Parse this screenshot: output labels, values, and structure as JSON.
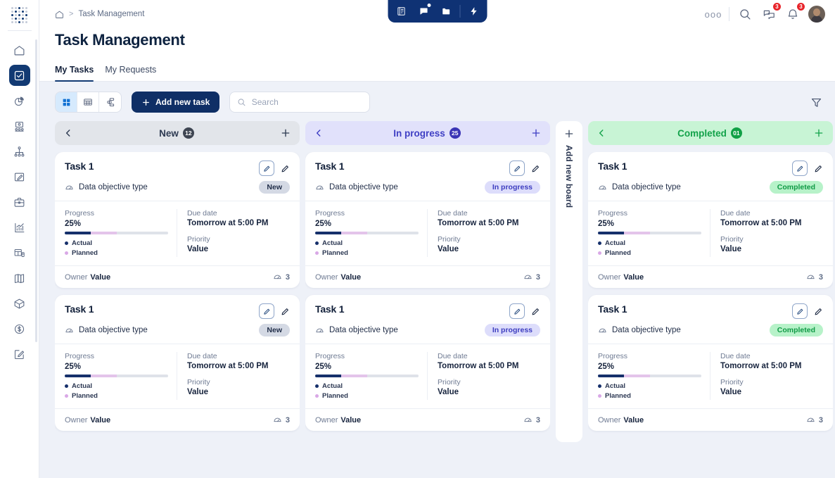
{
  "app": {
    "logo_name": "dots-logo"
  },
  "sidebar": {
    "items": [
      {
        "label": "Home",
        "icon": "home-icon",
        "active": false
      },
      {
        "label": "Tasks",
        "icon": "checkbox-icon",
        "active": true
      },
      {
        "label": "Analytics",
        "icon": "pie-chart-icon",
        "active": false
      },
      {
        "label": "Presentation",
        "icon": "presentation-people-icon",
        "active": false
      },
      {
        "label": "Org chart",
        "icon": "org-chart-icon",
        "active": false
      },
      {
        "label": "Edit document",
        "icon": "edit-document-icon",
        "active": false
      },
      {
        "label": "Portfolio",
        "icon": "briefcase-icon",
        "active": false
      },
      {
        "label": "Reports",
        "icon": "bar-chart-icon",
        "active": false
      },
      {
        "label": "Data tables",
        "icon": "table-database-icon",
        "active": false
      },
      {
        "label": "Catalog",
        "icon": "book-icon",
        "active": false
      },
      {
        "label": "Assets",
        "icon": "cube-icon",
        "active": false
      },
      {
        "label": "Finance",
        "icon": "dollar-circle-icon",
        "active": false
      },
      {
        "label": "Sign",
        "icon": "signature-icon",
        "active": false
      }
    ]
  },
  "topbar": {
    "breadcrumb_home": "home-icon",
    "breadcrumb_separator": ">",
    "breadcrumb_current": "Task Management",
    "center_tools": [
      {
        "name": "list-document-icon"
      },
      {
        "name": "chat-icon",
        "has_dot": true
      },
      {
        "name": "folder-icon"
      },
      {
        "name": "lightning-icon"
      }
    ],
    "more_label": "ooo",
    "search_icon": "search-icon",
    "messages_badge": "3",
    "notifications_badge": "3",
    "avatar_name": "user-avatar"
  },
  "page": {
    "title": "Task Management"
  },
  "tabs": [
    {
      "label": "My Tasks",
      "active": true
    },
    {
      "label": "My Requests",
      "active": false
    }
  ],
  "toolbar": {
    "views": [
      {
        "name": "grid-view-icon",
        "active": true
      },
      {
        "name": "table-view-icon",
        "active": false
      },
      {
        "name": "tree-view-icon",
        "active": false
      }
    ],
    "add_task_label": "Add new task",
    "search_placeholder": "Search",
    "search_value": "",
    "filter_icon": "filter-icon"
  },
  "add_board": {
    "label": "Add new board",
    "icon": "plus-icon"
  },
  "columns": [
    {
      "title": "New",
      "count": "12",
      "theme": "new",
      "cards": [
        {
          "title": "Task 1",
          "objective_type": "Data objective type",
          "status": "New",
          "progress_label": "Progress",
          "progress_value": "25%",
          "progress_actual": 25,
          "progress_planned": 25,
          "legend_actual": "Actual",
          "legend_planned": "Planned",
          "due_label": "Due date",
          "due_value": "Tomorrow at 5:00 PM",
          "priority_label": "Priority",
          "priority_value": "Value",
          "owner_label": "Owner",
          "owner_value": "Value",
          "objective_count": "3"
        },
        {
          "title": "Task 1",
          "objective_type": "Data objective type",
          "status": "New",
          "progress_label": "Progress",
          "progress_value": "25%",
          "progress_actual": 25,
          "progress_planned": 25,
          "legend_actual": "Actual",
          "legend_planned": "Planned",
          "due_label": "Due date",
          "due_value": "Tomorrow at 5:00 PM",
          "priority_label": "Priority",
          "priority_value": "Value",
          "owner_label": "Owner",
          "owner_value": "Value",
          "objective_count": "3"
        }
      ]
    },
    {
      "title": "In progress",
      "count": "25",
      "theme": "prog",
      "cards": [
        {
          "title": "Task 1",
          "objective_type": "Data objective type",
          "status": "In progress",
          "progress_label": "Progress",
          "progress_value": "25%",
          "progress_actual": 25,
          "progress_planned": 25,
          "legend_actual": "Actual",
          "legend_planned": "Planned",
          "due_label": "Due date",
          "due_value": "Tomorrow at 5:00 PM",
          "priority_label": "Priority",
          "priority_value": "Value",
          "owner_label": "Owner",
          "owner_value": "Value",
          "objective_count": "3"
        },
        {
          "title": "Task 1",
          "objective_type": "Data objective type",
          "status": "In progress",
          "progress_label": "Progress",
          "progress_value": "25%",
          "progress_actual": 25,
          "progress_planned": 25,
          "legend_actual": "Actual",
          "legend_planned": "Planned",
          "due_label": "Due date",
          "due_value": "Tomorrow at 5:00 PM",
          "priority_label": "Priority",
          "priority_value": "Value",
          "owner_label": "Owner",
          "owner_value": "Value",
          "objective_count": "3"
        }
      ]
    },
    {
      "title": "Completed",
      "count": "01",
      "theme": "done",
      "cards": [
        {
          "title": "Task 1",
          "objective_type": "Data objective type",
          "status": "Completed",
          "progress_label": "Progress",
          "progress_value": "25%",
          "progress_actual": 25,
          "progress_planned": 25,
          "legend_actual": "Actual",
          "legend_planned": "Planned",
          "due_label": "Due date",
          "due_value": "Tomorrow at 5:00 PM",
          "priority_label": "Priority",
          "priority_value": "Value",
          "owner_label": "Owner",
          "owner_value": "Value",
          "objective_count": "3"
        },
        {
          "title": "Task 1",
          "objective_type": "Data objective type",
          "status": "Completed",
          "progress_label": "Progress",
          "progress_value": "25%",
          "progress_actual": 25,
          "progress_planned": 25,
          "legend_actual": "Actual",
          "legend_planned": "Planned",
          "due_label": "Due date",
          "due_value": "Tomorrow at 5:00 PM",
          "priority_label": "Priority",
          "priority_value": "Value",
          "owner_label": "Owner",
          "owner_value": "Value",
          "objective_count": "3"
        }
      ]
    }
  ],
  "colors": {
    "brand_navy": "#0f2f66",
    "board_bg": "#eef1f8",
    "accent_blue": "#1272d3",
    "status_new_bg": "#d4d9e4",
    "status_progress_bg": "#ddddfb",
    "status_done_bg": "#b7f2c9",
    "badge_red": "#e8242a",
    "progress_actual": "#16306b",
    "progress_planned": "#e3c4ea"
  }
}
